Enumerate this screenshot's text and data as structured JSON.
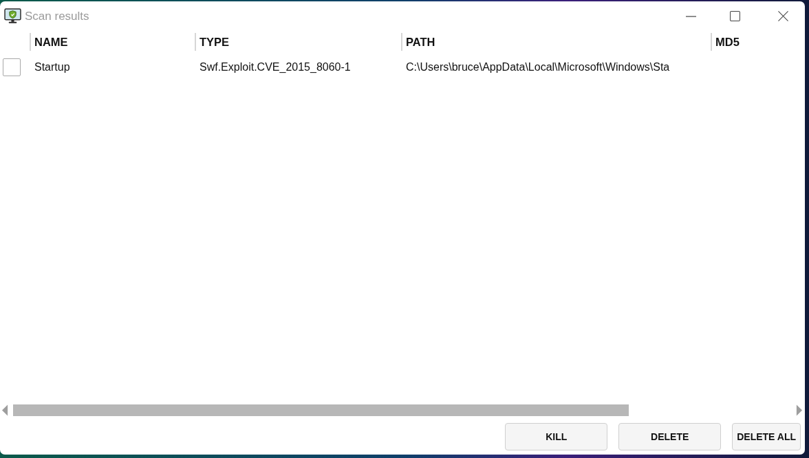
{
  "window": {
    "title": "Scan results"
  },
  "table": {
    "columns": [
      "NAME",
      "TYPE",
      "PATH",
      "MD5"
    ],
    "rows": [
      {
        "checked": false,
        "cells": [
          "Startup",
          "Swf.Exploit.CVE_2015_8060-1",
          "C:\\Users\\bruce\\AppData\\Local\\Microsoft\\Windows\\Sta"
        ]
      }
    ]
  },
  "buttons": [
    "KILL",
    "DELETE",
    "DELETE ALL"
  ]
}
